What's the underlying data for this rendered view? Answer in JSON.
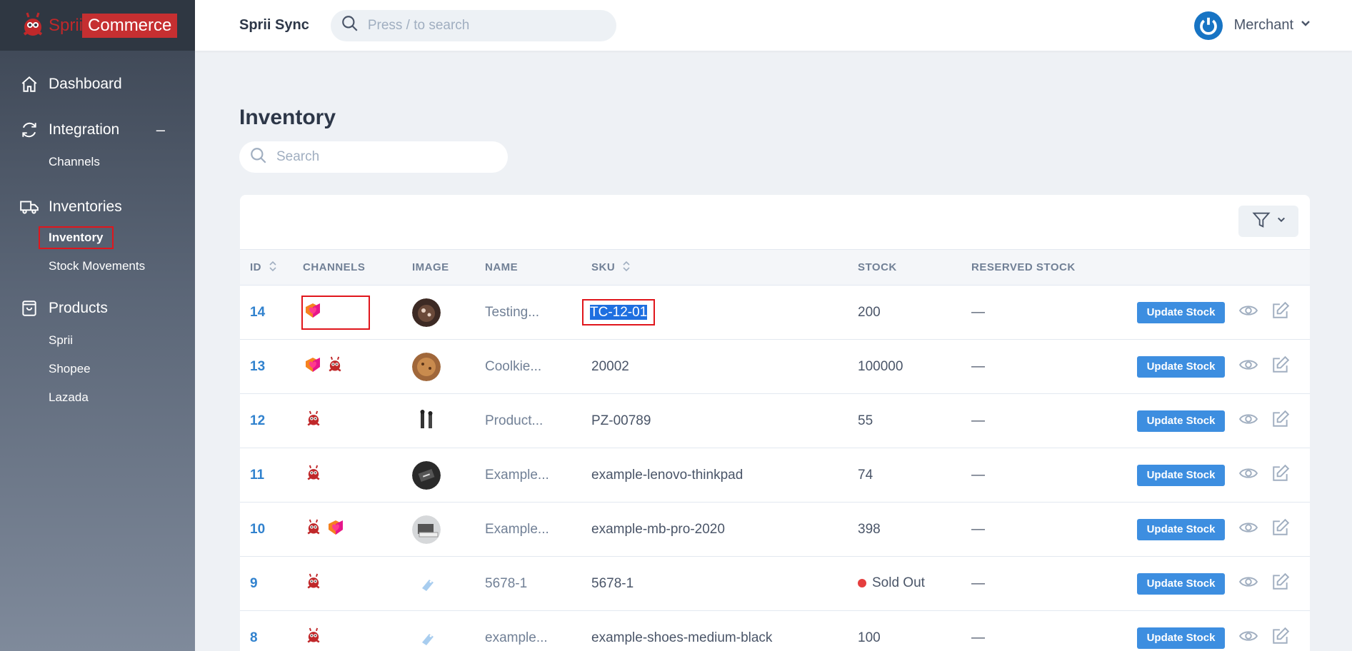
{
  "brand": {
    "part1": "Sprii",
    "part2": "Commerce"
  },
  "topbar": {
    "app_name": "Sprii Sync",
    "search_placeholder": "Press / to search",
    "user": "Merchant"
  },
  "sidebar": {
    "dashboard": "Dashboard",
    "integration": "Integration",
    "integration_collapse": "–",
    "channels": "Channels",
    "inventories": "Inventories",
    "inventory": "Inventory",
    "stock_movements": "Stock Movements",
    "products": "Products",
    "sprii": "Sprii",
    "shopee": "Shopee",
    "lazada": "Lazada"
  },
  "main": {
    "title": "Inventory",
    "search_placeholder": "Search"
  },
  "table": {
    "headers": {
      "id": "ID",
      "channels": "CHANNELS",
      "image": "IMAGE",
      "name": "NAME",
      "sku": "SKU",
      "stock": "STOCK",
      "reserved": "RESERVED STOCK"
    },
    "update_label": "Update Stock",
    "rows": [
      {
        "id": "14",
        "channels": [
          "lazada"
        ],
        "name": "Testing...",
        "sku": "TC-12-01",
        "stock": "200",
        "reserved": "—",
        "image": "cookie-dark"
      },
      {
        "id": "13",
        "channels": [
          "lazada",
          "sprii"
        ],
        "name": "Coolkie...",
        "sku": "20002",
        "stock": "100000",
        "reserved": "—",
        "image": "cookie-light"
      },
      {
        "id": "12",
        "channels": [
          "sprii"
        ],
        "name": "Product...",
        "sku": "PZ-00789",
        "stock": "55",
        "reserved": "—",
        "image": "figures"
      },
      {
        "id": "11",
        "channels": [
          "sprii"
        ],
        "name": "Example...",
        "sku": "example-lenovo-thinkpad",
        "stock": "74",
        "reserved": "—",
        "image": "laptop-dark"
      },
      {
        "id": "10",
        "channels": [
          "sprii",
          "lazada"
        ],
        "name": "Example...",
        "sku": "example-mb-pro-2020",
        "stock": "398",
        "reserved": "—",
        "image": "laptop-light"
      },
      {
        "id": "9",
        "channels": [
          "sprii"
        ],
        "name": "5678-1",
        "sku": "5678-1",
        "stock": "Sold Out",
        "reserved": "—",
        "image": "tag"
      },
      {
        "id": "8",
        "channels": [
          "sprii"
        ],
        "name": "example...",
        "sku": "example-shoes-medium-black",
        "stock": "100",
        "reserved": "—",
        "image": "tag"
      }
    ]
  },
  "colors": {
    "accent": "#3182ce",
    "button": "#3d8ee0",
    "brand_red": "#c62f31",
    "sold_out": "#e53e3e"
  }
}
